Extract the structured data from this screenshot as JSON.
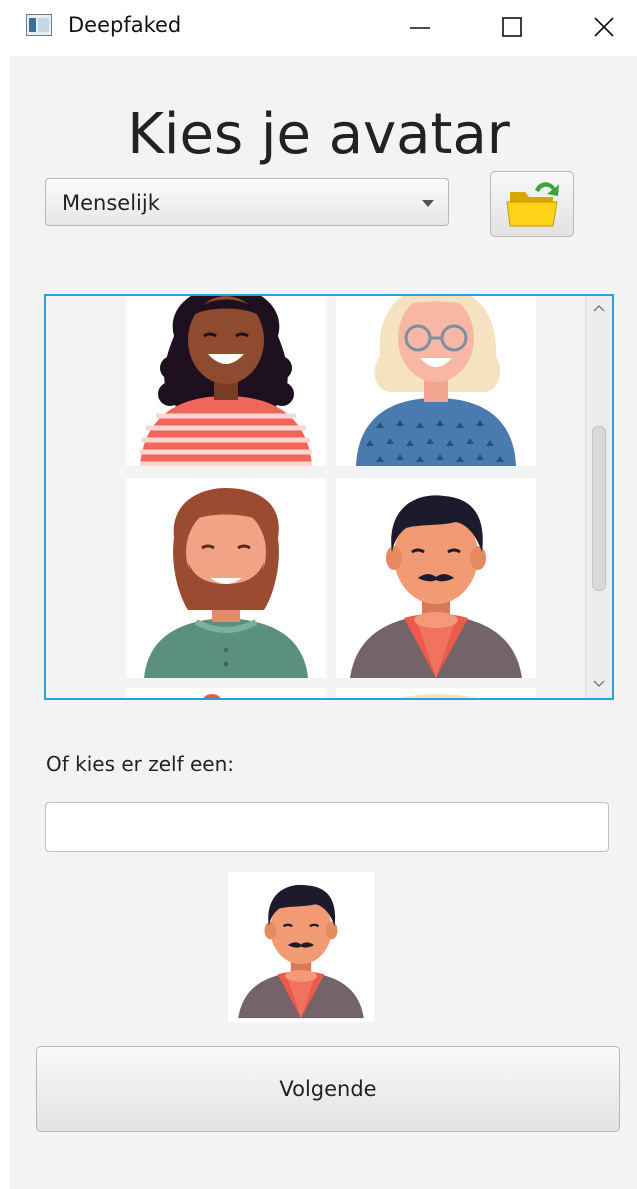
{
  "window": {
    "title": "Deepfaked"
  },
  "heading": "Kies je avatar",
  "category": {
    "selected": "Menselijk"
  },
  "gallery": {
    "avatars": [
      {
        "icon": "woman-dark-curly-hair-avatar"
      },
      {
        "icon": "woman-blonde-glasses-avatar"
      },
      {
        "icon": "man-beard-avatar"
      },
      {
        "icon": "man-mustache-avatar"
      }
    ]
  },
  "custom": {
    "label": "Of kies er zelf een:",
    "value": ""
  },
  "preview": {
    "icon": "man-mustache-avatar"
  },
  "next_button": "Volgende",
  "colors": {
    "focus_border": "#27a3d9",
    "background": "#f3f3f3"
  }
}
